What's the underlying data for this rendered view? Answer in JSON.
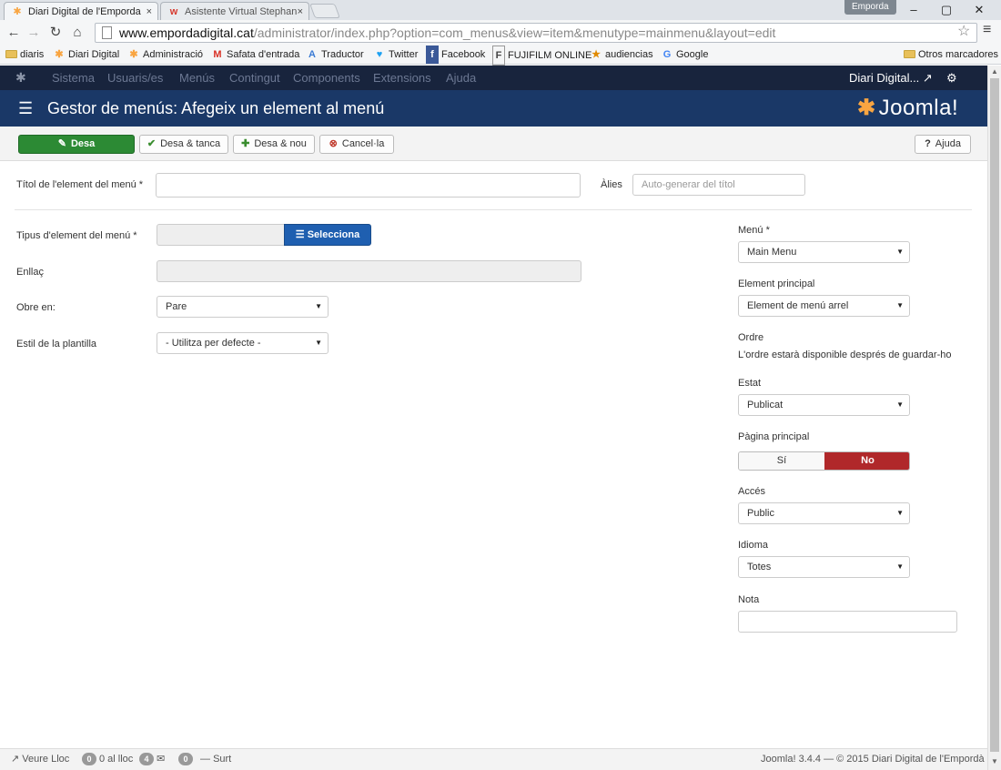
{
  "browser": {
    "tabs": [
      {
        "title": "Diari Digital de l'Emporda",
        "icon": "joomla-icon",
        "close": "×"
      },
      {
        "title": "Asistente Virtual Stephan",
        "icon": "w-icon",
        "close": "×"
      }
    ],
    "profile": "Emporda",
    "window_controls": [
      "–",
      "▢",
      "✕"
    ],
    "url_host": "www.empordadigital.cat",
    "url_path": "/administrator/index.php?option=com_menus&view=item&menutype=mainmenu&layout=edit",
    "bookmarks": [
      {
        "label": "diaris",
        "icon": "folder-icon"
      },
      {
        "label": "Diari Digital",
        "icon": "joomla-icon"
      },
      {
        "label": "Administració",
        "icon": "joomla-icon"
      },
      {
        "label": "Safata d'entrada",
        "icon": "gmail-icon"
      },
      {
        "label": "Traductor",
        "icon": "translate-icon"
      },
      {
        "label": "Twitter",
        "icon": "twitter-icon"
      },
      {
        "label": "Facebook",
        "icon": "facebook-icon"
      },
      {
        "label": "FUJIFILM ONLINE",
        "icon": "fujifilm-icon"
      },
      {
        "label": "audiencias",
        "icon": "star-icon"
      },
      {
        "label": "Google",
        "icon": "google-icon"
      }
    ],
    "other_bookmarks": "Otros marcadores"
  },
  "admin_nav": {
    "items": [
      "Sistema",
      "Usuaris/es",
      "Menús",
      "Contingut",
      "Components",
      "Extensions",
      "Ajuda"
    ],
    "site_link": "Diari Digital..."
  },
  "header": {
    "title": "Gestor de menús: Afegeix un element al menú",
    "brand": "Joomla!"
  },
  "toolbar": {
    "save": "Desa",
    "save_close": "Desa & tanca",
    "save_new": "Desa & nou",
    "cancel": "Cancel·la",
    "help": "Ajuda"
  },
  "form": {
    "title_label": "Títol de l'element del menú *",
    "title_value": "",
    "alias_label": "Àlies",
    "alias_placeholder": "Auto-generar del títol",
    "type_label": "Tipus d'element del menú *",
    "type_value": "",
    "select_button": "Selecciona",
    "link_label": "Enllaç",
    "link_value": "",
    "open_label": "Obre en:",
    "open_value": "Pare",
    "template_label": "Estil de la plantilla",
    "template_value": "- Utilitza per defecte -"
  },
  "sidebar": {
    "menu_label": "Menú *",
    "menu_value": "Main Menu",
    "parent_label": "Element principal",
    "parent_value": "Element de menú arrel",
    "order_label": "Ordre",
    "order_text": "L'ordre estarà disponible després de guardar-ho",
    "status_label": "Estat",
    "status_value": "Publicat",
    "home_label": "Pàgina principal",
    "home_yes": "Sí",
    "home_no": "No",
    "home_selected": "No",
    "access_label": "Accés",
    "access_value": "Public",
    "language_label": "Idioma",
    "language_value": "Totes",
    "note_label": "Nota",
    "note_value": ""
  },
  "statusbar": {
    "view_site": "Veure Lloc",
    "visitors_count": "0",
    "visitors_text": "0 al lloc",
    "admins_count": "4",
    "messages_count": "0",
    "logout": "Surt",
    "version": "Joomla! 3.4.4 — © 2015 Diari Digital de l'Empordà"
  },
  "colors": {
    "nav_bg": "#18243d",
    "header_bg": "#1a3867",
    "save_green": "#2c8a34",
    "select_blue": "#1f5fb0",
    "toggle_red": "#b0282a"
  }
}
